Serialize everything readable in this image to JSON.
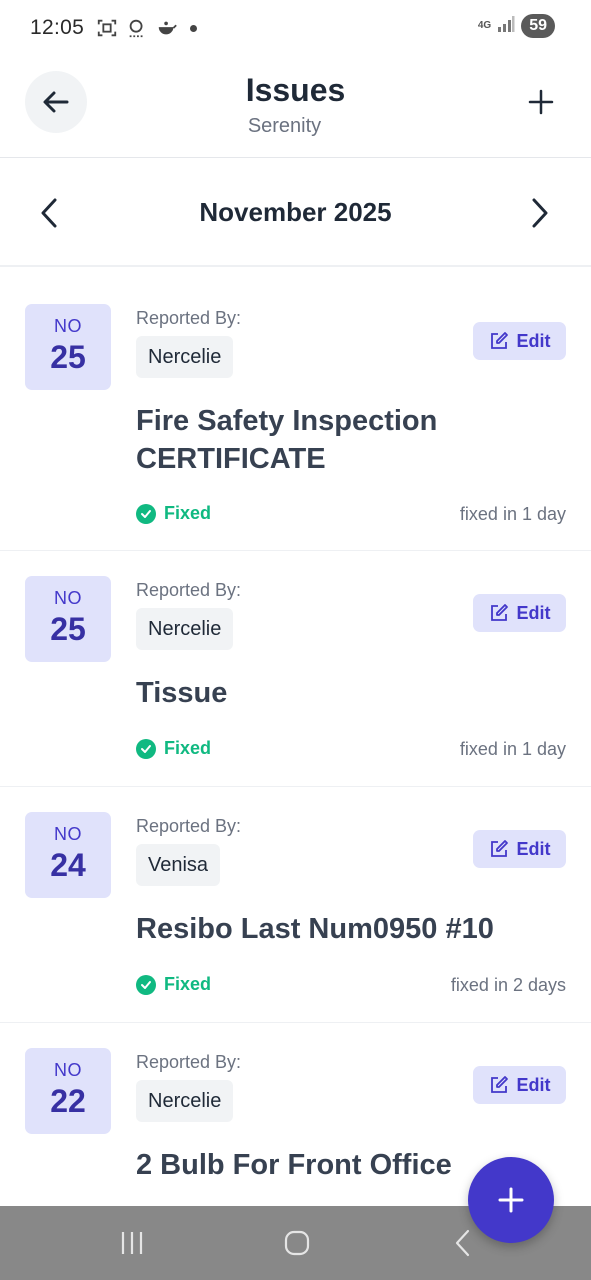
{
  "status_bar": {
    "time": "12:05",
    "network": "4G",
    "battery": "59",
    "icons": [
      "screenshot-icon",
      "search-icon",
      "teapot-icon",
      "dot-icon",
      "signal-icon"
    ]
  },
  "header": {
    "title": "Issues",
    "subtitle": "Serenity",
    "back_icon": "arrow-left-icon",
    "add_icon": "plus-icon"
  },
  "month_nav": {
    "label": "November 2025",
    "prev_icon": "chevron-left-icon",
    "next_icon": "chevron-right-icon"
  },
  "issues": [
    {
      "month": "NO",
      "day": "25",
      "reported_label": "Reported By:",
      "reporter": "Nercelie",
      "edit_label": "Edit",
      "title": "Fire Safety Inspection CERTIFICATE",
      "status": "Fixed",
      "fixed_in": "fixed in 1 day"
    },
    {
      "month": "NO",
      "day": "25",
      "reported_label": "Reported By:",
      "reporter": "Nercelie",
      "edit_label": "Edit",
      "title": "Tissue",
      "status": "Fixed",
      "fixed_in": "fixed in 1 day"
    },
    {
      "month": "NO",
      "day": "24",
      "reported_label": "Reported By:",
      "reporter": "Venisa",
      "edit_label": "Edit",
      "title": "Resibo Last Num0950 #10",
      "status": "Fixed",
      "fixed_in": "fixed in 2 days"
    },
    {
      "month": "NO",
      "day": "22",
      "reported_label": "Reported By:",
      "reporter": "Nercelie",
      "edit_label": "Edit",
      "title": "2 Bulb For Front Office",
      "status": "",
      "fixed_in": ""
    }
  ],
  "fab": {
    "icon": "plus-icon"
  },
  "nav_bar": {
    "icons": [
      "recent-apps-icon",
      "home-icon",
      "back-icon"
    ]
  },
  "colors": {
    "accent": "#4338ca",
    "badge_bg": "#e0e2fb",
    "success": "#10b981",
    "text_dark": "#1f2937",
    "text_muted": "#6b7280"
  }
}
